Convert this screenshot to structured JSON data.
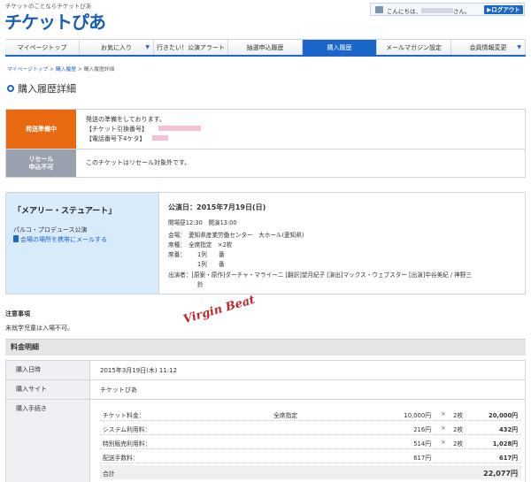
{
  "header": {
    "tagline": "チケットのことならチケットぴあ",
    "logo": "チケットぴあ",
    "greeting": "こんにちは、",
    "greeting_suffix": "さん。",
    "logout_label": "ログアウト"
  },
  "nav": {
    "items": [
      {
        "label": "マイページトップ",
        "dropdown": ""
      },
      {
        "label": "お気に入り",
        "dropdown": "▼"
      },
      {
        "label": "行きたい！公演アラート",
        "dropdown": ""
      },
      {
        "label": "抽選申込履歴",
        "dropdown": ""
      },
      {
        "label": "購入履歴",
        "dropdown": ""
      },
      {
        "label": "メールマガジン設定",
        "dropdown": ""
      },
      {
        "label": "会員情報変更",
        "dropdown": "▼"
      }
    ],
    "active_index": 4
  },
  "breadcrumb": {
    "items": [
      "マイページトップ",
      "購入履歴",
      "購入履歴詳細"
    ],
    "separator": " > "
  },
  "page_title": "購入履歴詳細",
  "status": {
    "label": "発送準備中",
    "message": "発送の準備をしております。",
    "ticket_code_label": "【チケット引換番号】",
    "phone_label": "【電話番号下4ケタ】",
    "color": "#e8690f"
  },
  "resale": {
    "label_line1": "リセール",
    "label_line2": "申込不可",
    "message": "このチケットはリセール対象外です。",
    "color": "#9aa1ae"
  },
  "event": {
    "name": "「メアリー・ステュアート」",
    "presenter": "パルコ・プロデュース公演",
    "mail_link": "会場の場所を携帯にメールする",
    "date": "公演日：2015年7月19日(日)",
    "times": "開場昼12:30　開演13:00",
    "venue": "会場：　愛知県産業労働センター　大ホール(愛知県)",
    "seat_type": "席種：　全席指定　×2枚",
    "seat_label": "席番：",
    "seat_1": "1列　　番",
    "seat_2": "1列　　番",
    "cast_line1": "出演者：[原案・原作]ダーチャ・マライーニ [翻訳]望月紀子 [演出]マックス・ウェブスター [出演]中谷美紀 / 神野三",
    "cast_line2": "鈴"
  },
  "handwriting": "Virgin Beat",
  "notes": {
    "title": "注意事項",
    "body": "未就学児童は入場不可。"
  },
  "fees": {
    "title": "料金明細",
    "purchase_date_label": "購入日時",
    "purchase_date": "2015年3月19日(木) 11:12",
    "purchase_site_label": "購入サイト",
    "purchase_site": "チケットぴあ",
    "procedure_label": "購入手続き",
    "rows": [
      {
        "name": "チケット料金：",
        "seat": "全席指定",
        "unit": "10,000円",
        "x": "×",
        "qty": "2枚",
        "amount": "20,000円"
      },
      {
        "name": "システム利用料：",
        "seat": "",
        "unit": "216円",
        "x": "×",
        "qty": "2枚",
        "amount": "432円"
      },
      {
        "name": "特別販売利用料：",
        "seat": "",
        "unit": "514円",
        "x": "×",
        "qty": "2枚",
        "amount": "1,028円"
      },
      {
        "name": "配送手数料：",
        "seat": "",
        "unit": "617円",
        "x": "",
        "qty": "",
        "amount": "617円"
      }
    ],
    "total_label": "合計",
    "total_amount": "22,077円"
  },
  "colors": {
    "accent": "#1b66c9",
    "status_orange": "#e8690f",
    "resale_gray": "#9aa1ae",
    "event_bg": "#d7ebfa"
  }
}
